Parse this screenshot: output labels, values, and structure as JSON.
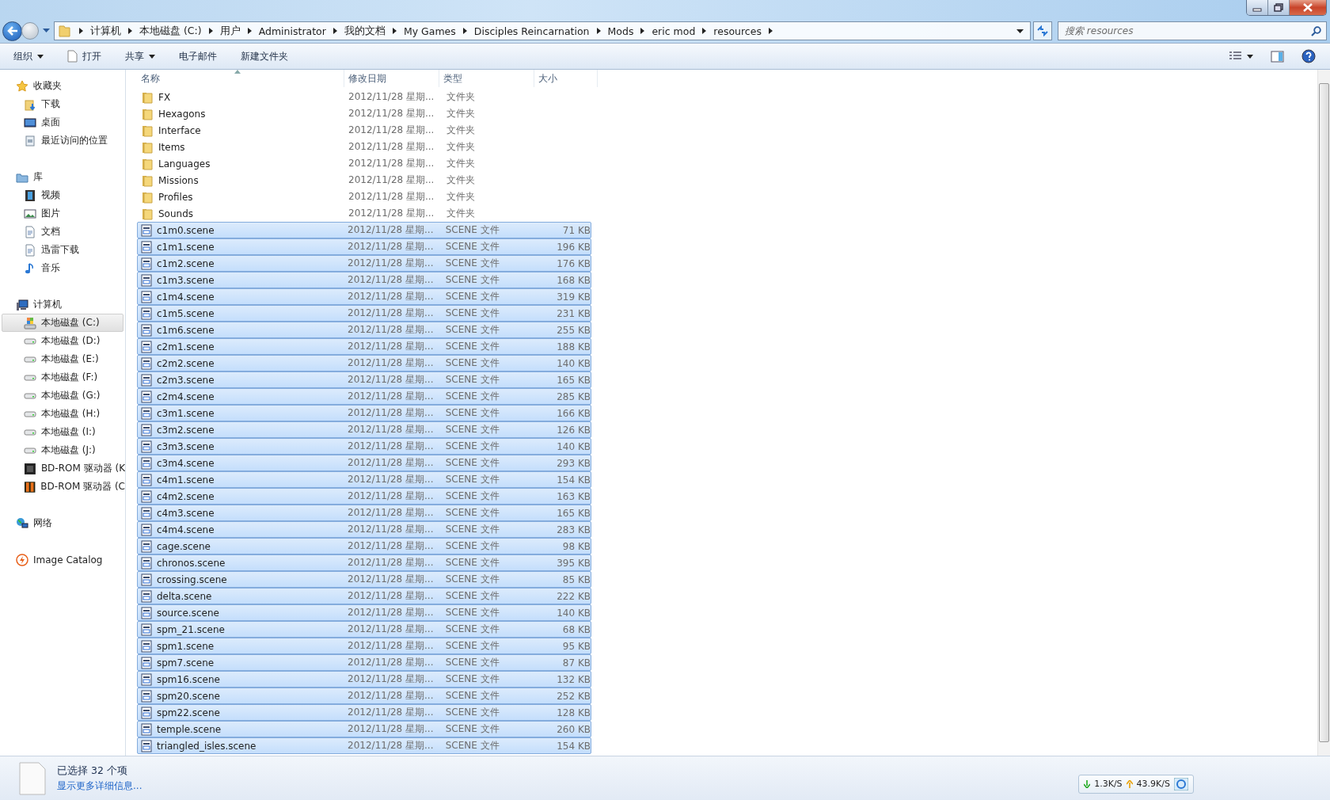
{
  "address_bar": {
    "segments": [
      "计算机",
      "本地磁盘 (C:)",
      "用户",
      "Administrator",
      "我的文档",
      "My Games",
      "Disciples Reincarnation",
      "Mods",
      "eric mod",
      "resources"
    ]
  },
  "search": {
    "placeholder": "搜索 resources"
  },
  "toolbar": [
    {
      "label": "组织",
      "kind": "menu"
    },
    {
      "label": "打开",
      "kind": "open"
    },
    {
      "label": "共享",
      "kind": "menu"
    },
    {
      "label": "电子邮件",
      "kind": "plain"
    },
    {
      "label": "新建文件夹",
      "kind": "plain"
    }
  ],
  "sidebar": [
    {
      "label": "收藏夹",
      "kind": "star",
      "items": [
        {
          "label": "下载",
          "kind": "downloads",
          "selected": false
        },
        {
          "label": "桌面",
          "kind": "desktop",
          "selected": false
        },
        {
          "label": "最近访问的位置",
          "kind": "recent",
          "selected": false
        }
      ]
    },
    {
      "label": "库",
      "kind": "library",
      "items": [
        {
          "label": "视频",
          "kind": "video",
          "selected": false
        },
        {
          "label": "图片",
          "kind": "pictures",
          "selected": false
        },
        {
          "label": "文档",
          "kind": "documents",
          "selected": false
        },
        {
          "label": "迅雷下载",
          "kind": "documents",
          "selected": false
        },
        {
          "label": "音乐",
          "kind": "music",
          "selected": false
        }
      ]
    },
    {
      "label": "计算机",
      "kind": "computer",
      "items": [
        {
          "label": "本地磁盘 (C:)",
          "kind": "system-drive",
          "selected": true
        },
        {
          "label": "本地磁盘 (D:)",
          "kind": "drive",
          "selected": false
        },
        {
          "label": "本地磁盘 (E:)",
          "kind": "drive",
          "selected": false
        },
        {
          "label": "本地磁盘 (F:)",
          "kind": "drive",
          "selected": false
        },
        {
          "label": "本地磁盘 (G:)",
          "kind": "drive",
          "selected": false
        },
        {
          "label": "本地磁盘 (H:)",
          "kind": "drive",
          "selected": false
        },
        {
          "label": "本地磁盘 (I:)",
          "kind": "drive",
          "selected": false
        },
        {
          "label": "本地磁盘 (J:)",
          "kind": "drive",
          "selected": false
        },
        {
          "label": "BD-ROM 驱动器 (K",
          "kind": "bd-dark",
          "selected": false
        },
        {
          "label": "BD-ROM 驱动器 (C",
          "kind": "bd-orange",
          "selected": false
        }
      ]
    },
    {
      "label": "网络",
      "kind": "network"
    },
    {
      "label": "Image Catalog",
      "kind": "catalog"
    }
  ],
  "table": {
    "columns": [
      {
        "label": "名称",
        "sorted": true
      },
      {
        "label": "修改日期",
        "sorted": false
      },
      {
        "label": "类型",
        "sorted": false
      },
      {
        "label": "大小",
        "sorted": false
      }
    ],
    "rows": [
      {
        "name": "FX",
        "date": "2012/11/28 星期...",
        "type": "文件夹",
        "kind": "folder",
        "selected": false
      },
      {
        "name": "Hexagons",
        "date": "2012/11/28 星期...",
        "type": "文件夹",
        "kind": "folder",
        "selected": false
      },
      {
        "name": "Interface",
        "date": "2012/11/28 星期...",
        "type": "文件夹",
        "kind": "folder",
        "selected": false
      },
      {
        "name": "Items",
        "date": "2012/11/28 星期...",
        "type": "文件夹",
        "kind": "folder",
        "selected": false
      },
      {
        "name": "Languages",
        "date": "2012/11/28 星期...",
        "type": "文件夹",
        "kind": "folder",
        "selected": false
      },
      {
        "name": "Missions",
        "date": "2012/11/28 星期...",
        "type": "文件夹",
        "kind": "folder",
        "selected": false
      },
      {
        "name": "Profiles",
        "date": "2012/11/28 星期...",
        "type": "文件夹",
        "kind": "folder",
        "selected": false
      },
      {
        "name": "Sounds",
        "date": "2012/11/28 星期...",
        "type": "文件夹",
        "kind": "folder",
        "selected": false
      },
      {
        "name": "c1m0.scene",
        "date": "2012/11/28 星期...",
        "type": "SCENE 文件",
        "size": "71 KB",
        "kind": "file",
        "selected": true
      },
      {
        "name": "c1m1.scene",
        "date": "2012/11/28 星期...",
        "type": "SCENE 文件",
        "size": "196 KB",
        "kind": "file",
        "selected": true
      },
      {
        "name": "c1m2.scene",
        "date": "2012/11/28 星期...",
        "type": "SCENE 文件",
        "size": "176 KB",
        "kind": "file",
        "selected": true
      },
      {
        "name": "c1m3.scene",
        "date": "2012/11/28 星期...",
        "type": "SCENE 文件",
        "size": "168 KB",
        "kind": "file",
        "selected": true
      },
      {
        "name": "c1m4.scene",
        "date": "2012/11/28 星期...",
        "type": "SCENE 文件",
        "size": "319 KB",
        "kind": "file",
        "selected": true
      },
      {
        "name": "c1m5.scene",
        "date": "2012/11/28 星期...",
        "type": "SCENE 文件",
        "size": "231 KB",
        "kind": "file",
        "selected": true
      },
      {
        "name": "c1m6.scene",
        "date": "2012/11/28 星期...",
        "type": "SCENE 文件",
        "size": "255 KB",
        "kind": "file",
        "selected": true
      },
      {
        "name": "c2m1.scene",
        "date": "2012/11/28 星期...",
        "type": "SCENE 文件",
        "size": "188 KB",
        "kind": "file",
        "selected": true
      },
      {
        "name": "c2m2.scene",
        "date": "2012/11/28 星期...",
        "type": "SCENE 文件",
        "size": "140 KB",
        "kind": "file",
        "selected": true
      },
      {
        "name": "c2m3.scene",
        "date": "2012/11/28 星期...",
        "type": "SCENE 文件",
        "size": "165 KB",
        "kind": "file",
        "selected": true
      },
      {
        "name": "c2m4.scene",
        "date": "2012/11/28 星期...",
        "type": "SCENE 文件",
        "size": "285 KB",
        "kind": "file",
        "selected": true
      },
      {
        "name": "c3m1.scene",
        "date": "2012/11/28 星期...",
        "type": "SCENE 文件",
        "size": "166 KB",
        "kind": "file",
        "selected": true
      },
      {
        "name": "c3m2.scene",
        "date": "2012/11/28 星期...",
        "type": "SCENE 文件",
        "size": "126 KB",
        "kind": "file",
        "selected": true
      },
      {
        "name": "c3m3.scene",
        "date": "2012/11/28 星期...",
        "type": "SCENE 文件",
        "size": "140 KB",
        "kind": "file",
        "selected": true
      },
      {
        "name": "c3m4.scene",
        "date": "2012/11/28 星期...",
        "type": "SCENE 文件",
        "size": "293 KB",
        "kind": "file",
        "selected": true
      },
      {
        "name": "c4m1.scene",
        "date": "2012/11/28 星期...",
        "type": "SCENE 文件",
        "size": "154 KB",
        "kind": "file",
        "selected": true
      },
      {
        "name": "c4m2.scene",
        "date": "2012/11/28 星期...",
        "type": "SCENE 文件",
        "size": "163 KB",
        "kind": "file",
        "selected": true
      },
      {
        "name": "c4m3.scene",
        "date": "2012/11/28 星期...",
        "type": "SCENE 文件",
        "size": "165 KB",
        "kind": "file",
        "selected": true
      },
      {
        "name": "c4m4.scene",
        "date": "2012/11/28 星期...",
        "type": "SCENE 文件",
        "size": "283 KB",
        "kind": "file",
        "selected": true
      },
      {
        "name": "cage.scene",
        "date": "2012/11/28 星期...",
        "type": "SCENE 文件",
        "size": "98 KB",
        "kind": "file",
        "selected": true
      },
      {
        "name": "chronos.scene",
        "date": "2012/11/28 星期...",
        "type": "SCENE 文件",
        "size": "395 KB",
        "kind": "file",
        "selected": true
      },
      {
        "name": "crossing.scene",
        "date": "2012/11/28 星期...",
        "type": "SCENE 文件",
        "size": "85 KB",
        "kind": "file",
        "selected": true
      },
      {
        "name": "delta.scene",
        "date": "2012/11/28 星期...",
        "type": "SCENE 文件",
        "size": "222 KB",
        "kind": "file",
        "selected": true
      },
      {
        "name": "source.scene",
        "date": "2012/11/28 星期...",
        "type": "SCENE 文件",
        "size": "140 KB",
        "kind": "file",
        "selected": true
      },
      {
        "name": "spm_21.scene",
        "date": "2012/11/28 星期...",
        "type": "SCENE 文件",
        "size": "68 KB",
        "kind": "file",
        "selected": true
      },
      {
        "name": "spm1.scene",
        "date": "2012/11/28 星期...",
        "type": "SCENE 文件",
        "size": "95 KB",
        "kind": "file",
        "selected": true
      },
      {
        "name": "spm7.scene",
        "date": "2012/11/28 星期...",
        "type": "SCENE 文件",
        "size": "87 KB",
        "kind": "file",
        "selected": true
      },
      {
        "name": "spm16.scene",
        "date": "2012/11/28 星期...",
        "type": "SCENE 文件",
        "size": "132 KB",
        "kind": "file",
        "selected": true
      },
      {
        "name": "spm20.scene",
        "date": "2012/11/28 星期...",
        "type": "SCENE 文件",
        "size": "252 KB",
        "kind": "file",
        "selected": true
      },
      {
        "name": "spm22.scene",
        "date": "2012/11/28 星期...",
        "type": "SCENE 文件",
        "size": "128 KB",
        "kind": "file",
        "selected": true
      },
      {
        "name": "temple.scene",
        "date": "2012/11/28 星期...",
        "type": "SCENE 文件",
        "size": "260 KB",
        "kind": "file",
        "selected": true
      },
      {
        "name": "triangled_isles.scene",
        "date": "2012/11/28 星期...",
        "type": "SCENE 文件",
        "size": "154 KB",
        "kind": "file",
        "selected": true
      }
    ]
  },
  "status_bar": {
    "summary": "已选择 32 个项",
    "details_link": "显示更多详细信息...",
    "download_speed": "1.3K/S",
    "upload_speed": "43.9K/S"
  }
}
